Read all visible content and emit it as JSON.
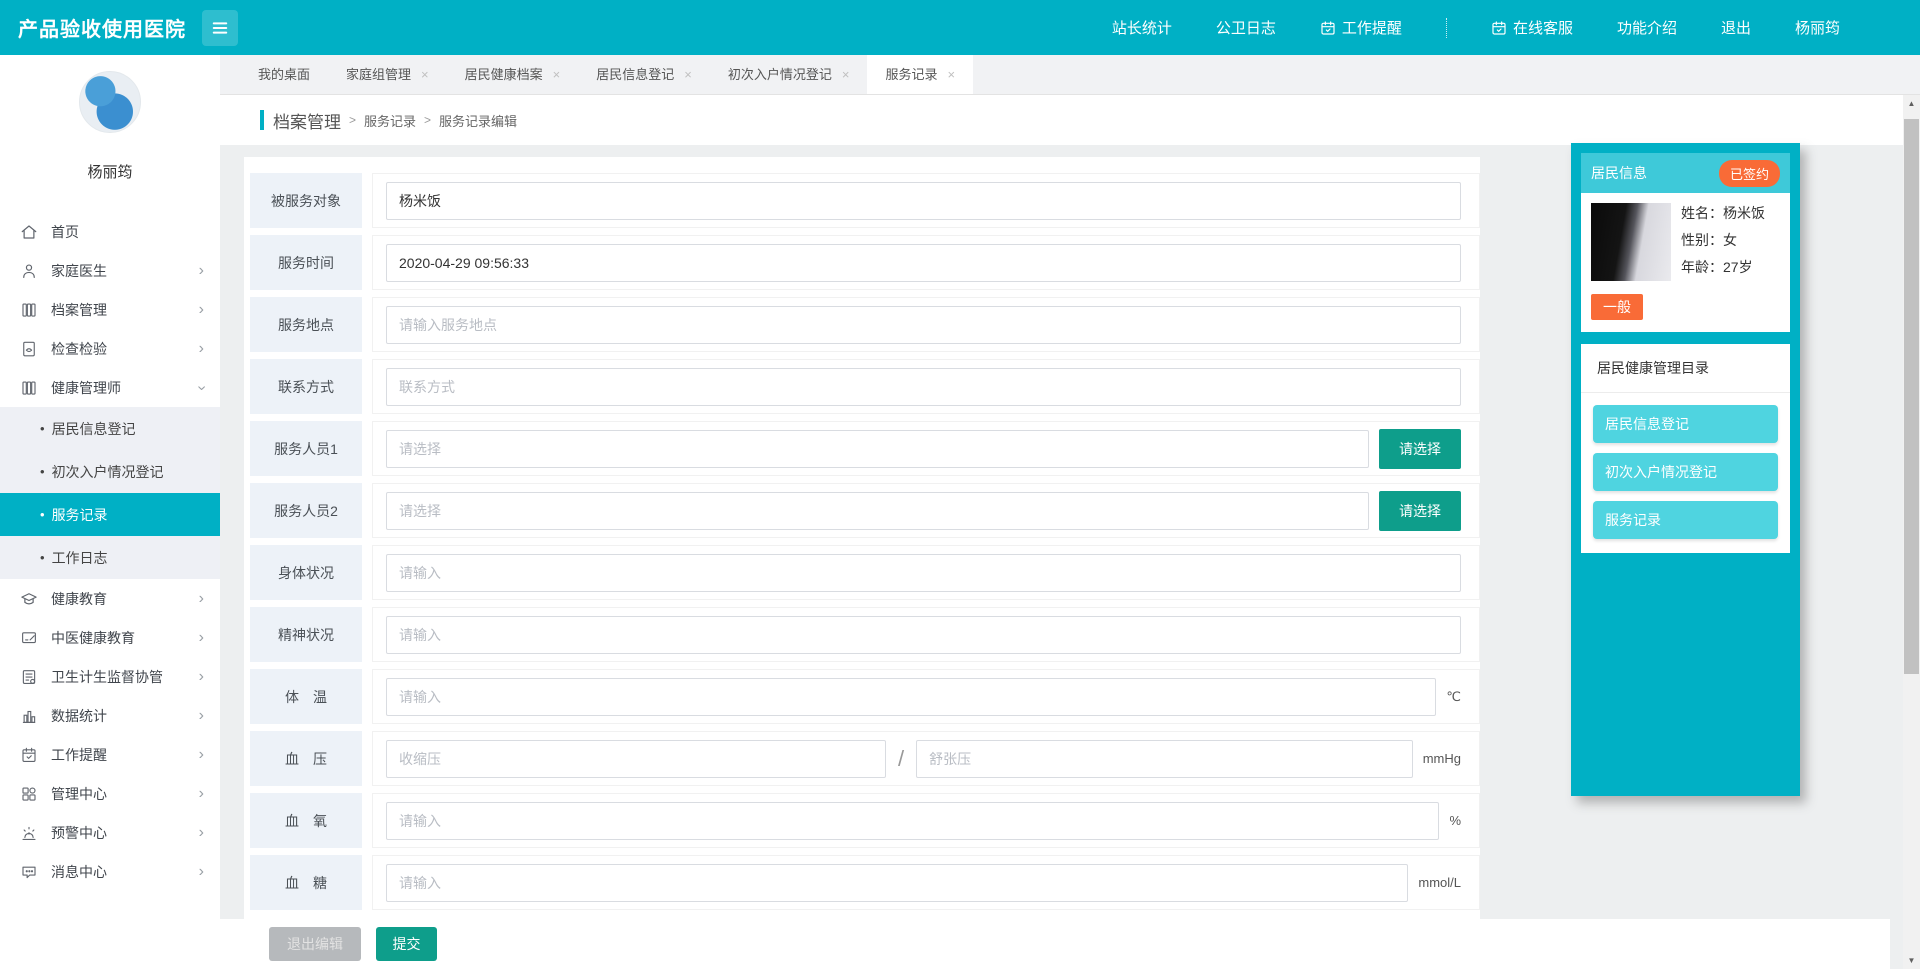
{
  "ui": {
    "close": "×",
    "chevron": "›",
    "bullet": "•",
    "arrow_up": "▲",
    "arrow_down": "▼",
    "crumb_sep": ">",
    "bp_sep": "/"
  },
  "colors": {
    "teal": "#00b0c5",
    "green": "#0e9e8b",
    "orange": "#f96b37",
    "panel_header": "#3ec9d9",
    "catalog_button": "#4fd4e0"
  },
  "header": {
    "title": "产品验收使用医院",
    "nav": [
      {
        "label": "站长统计"
      },
      {
        "label": "公卫日志"
      },
      {
        "label": "工作提醒",
        "icon": "calendar-icon"
      },
      {
        "label": "在线客服",
        "icon": "calendar-icon"
      },
      {
        "label": "功能介绍"
      },
      {
        "label": "退出"
      },
      {
        "label": "杨丽筠"
      }
    ]
  },
  "sidebar": {
    "username": "杨丽筠",
    "items": [
      {
        "label": "首页"
      },
      {
        "label": "家庭医生"
      },
      {
        "label": "档案管理"
      },
      {
        "label": "检查检验"
      },
      {
        "label": "健康管理师"
      }
    ],
    "submenu": [
      {
        "label": "居民信息登记"
      },
      {
        "label": "初次入户情况登记"
      },
      {
        "label": "服务记录"
      },
      {
        "label": "工作日志"
      }
    ],
    "items2": [
      {
        "label": "健康教育"
      },
      {
        "label": "中医健康教育"
      },
      {
        "label": "卫生计生监督协管"
      },
      {
        "label": "数据统计"
      },
      {
        "label": "工作提醒"
      },
      {
        "label": "管理中心"
      },
      {
        "label": "预警中心"
      },
      {
        "label": "消息中心"
      }
    ]
  },
  "tabs": [
    {
      "label": "我的桌面"
    },
    {
      "label": "家庭组管理"
    },
    {
      "label": "居民健康档案"
    },
    {
      "label": "居民信息登记"
    },
    {
      "label": "初次入户情况登记"
    },
    {
      "label": "服务记录"
    }
  ],
  "breadcrumb": {
    "root": "档案管理",
    "items": [
      "服务记录",
      "服务记录编辑"
    ]
  },
  "form": {
    "rows": [
      {
        "label": "被服务对象",
        "value": "杨米饭"
      },
      {
        "label": "服务时间",
        "value": "2020-04-29 09:56:33"
      },
      {
        "label": "服务地点",
        "placeholder": "请输入服务地点"
      },
      {
        "label": "联系方式",
        "placeholder": "联系方式"
      },
      {
        "label": "服务人员1",
        "placeholder": "请选择",
        "button": "请选择"
      },
      {
        "label": "服务人员2",
        "placeholder": "请选择",
        "button": "请选择"
      },
      {
        "label": "身体状况",
        "placeholder": "请输入"
      },
      {
        "label": "精神状况",
        "placeholder": "请输入"
      },
      {
        "label": "体　温",
        "placeholder": "请输入",
        "unit": "℃"
      },
      {
        "label": "血　压",
        "ph1": "收缩压",
        "ph2": "舒张压",
        "unit": "mmHg"
      },
      {
        "label": "血　氧",
        "placeholder": "请输入",
        "unit": "%"
      },
      {
        "label": "血　糖",
        "placeholder": "请输入",
        "unit": "mmol/L"
      }
    ]
  },
  "footer": {
    "cancel": "退出编辑",
    "submit": "提交"
  },
  "panel": {
    "title": "居民信息",
    "badge": "已签约",
    "fields": [
      {
        "k": "姓名：",
        "v": "杨米饭"
      },
      {
        "k": "性别：",
        "v": "女"
      },
      {
        "k": "年龄：",
        "v": "27岁"
      }
    ],
    "level": "一般",
    "catalog_title": "居民健康管理目录",
    "catalog": [
      "居民信息登记",
      "初次入户情况登记",
      "服务记录"
    ]
  }
}
